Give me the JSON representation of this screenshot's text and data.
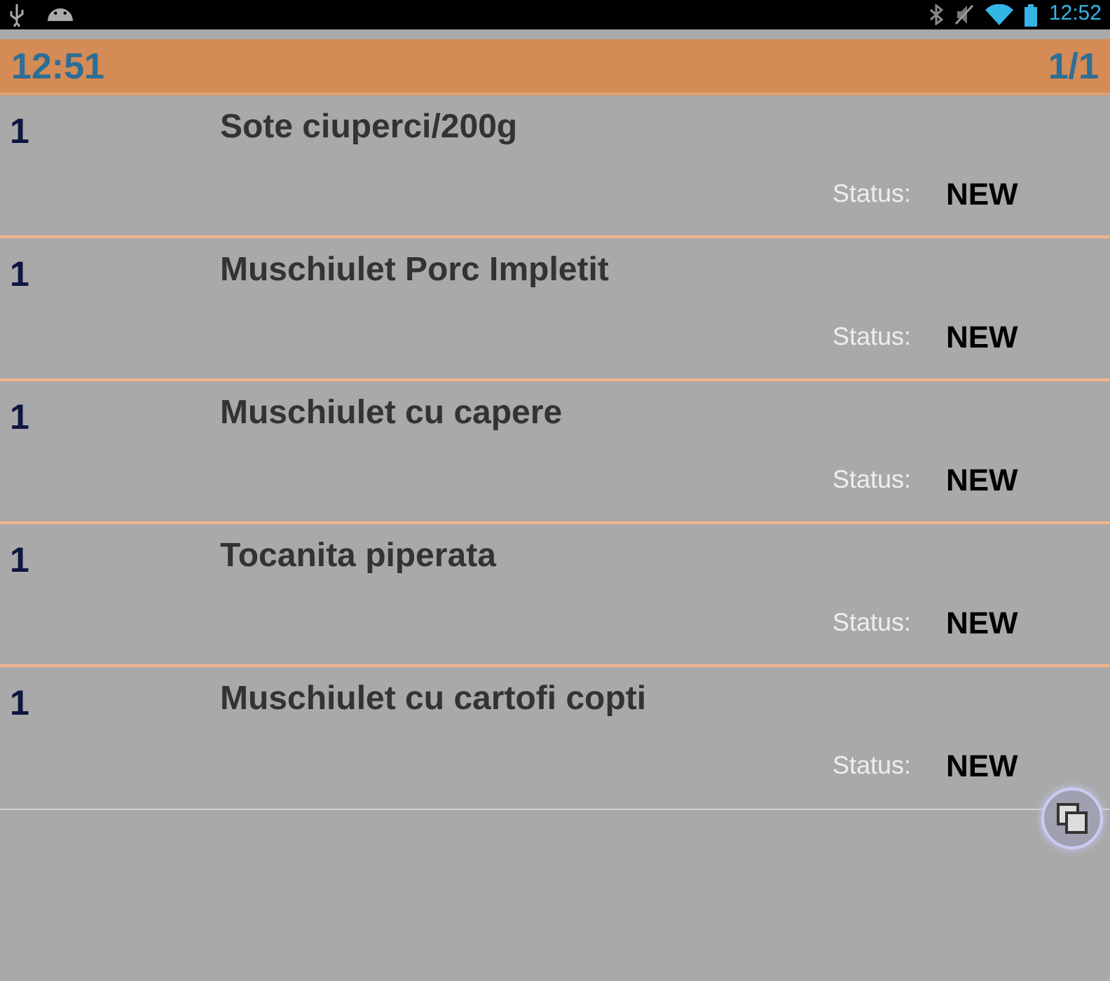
{
  "status_bar": {
    "time": "12:52"
  },
  "header": {
    "time": "12:51",
    "page": "1/1"
  },
  "items": [
    {
      "quantity": "1",
      "name": "Sote ciuperci/200g",
      "status_label": "Status:",
      "status": "NEW"
    },
    {
      "quantity": "1",
      "name": "Muschiulet Porc Impletit",
      "status_label": "Status:",
      "status": "NEW"
    },
    {
      "quantity": "1",
      "name": "Muschiulet cu capere",
      "status_label": "Status:",
      "status": "NEW"
    },
    {
      "quantity": "1",
      "name": "Tocanita piperata",
      "status_label": "Status:",
      "status": "NEW"
    },
    {
      "quantity": "1",
      "name": "Muschiulet cu cartofi copti",
      "status_label": "Status:",
      "status": "NEW"
    }
  ]
}
